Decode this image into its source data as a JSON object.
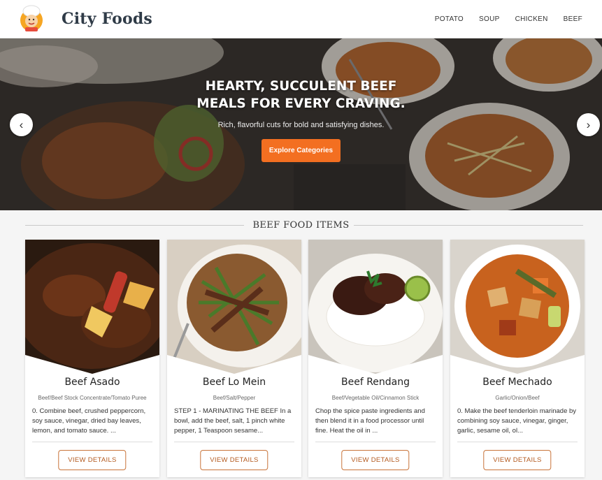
{
  "brand": {
    "name": "City Foods"
  },
  "nav": {
    "items": [
      "POTATO",
      "SOUP",
      "CHICKEN",
      "BEEF"
    ]
  },
  "hero": {
    "title_line1": "HEARTY, SUCCULENT BEEF",
    "title_line2": "MEALS FOR EVERY CRAVING.",
    "subtitle": "Rich, flavorful cuts for bold and satisfying dishes.",
    "button": "Explore Categories",
    "prev": "‹",
    "next": "›"
  },
  "section": {
    "title": "BEEF FOOD ITEMS"
  },
  "cards": [
    {
      "title": "Beef Asado",
      "tags": "Beef/Beef Stock Concentrate/Tomato Puree",
      "desc": "0. Combine beef, crushed peppercorn, soy sauce, vinegar, dried bay leaves, lemon, and tomato sauce. ...",
      "button": "VIEW DETAILS"
    },
    {
      "title": "Beef Lo Mein",
      "tags": "Beef/Salt/Pepper",
      "desc": "STEP 1 - MARINATING THE BEEF In a bowl, add the beef, salt, 1 pinch white pepper, 1 Teaspoon sesame...",
      "button": "VIEW DETAILS"
    },
    {
      "title": "Beef Rendang",
      "tags": "Beef/Vegetable Oil/Cinnamon Stick",
      "desc": "Chop the spice paste ingredients and then blend it in a food processor until fine. Heat the oil in ...",
      "button": "VIEW DETAILS"
    },
    {
      "title": "Beef Mechado",
      "tags": "Garlic/Onion/Beef",
      "desc": "0. Make the beef tenderloin marinade by combining soy sauce, vinegar, ginger, garlic, sesame oil, ol...",
      "button": "VIEW DETAILS"
    }
  ],
  "colors": {
    "accent": "#f36f21",
    "button_border": "#c8743a",
    "brand_text": "#2f3b47"
  }
}
